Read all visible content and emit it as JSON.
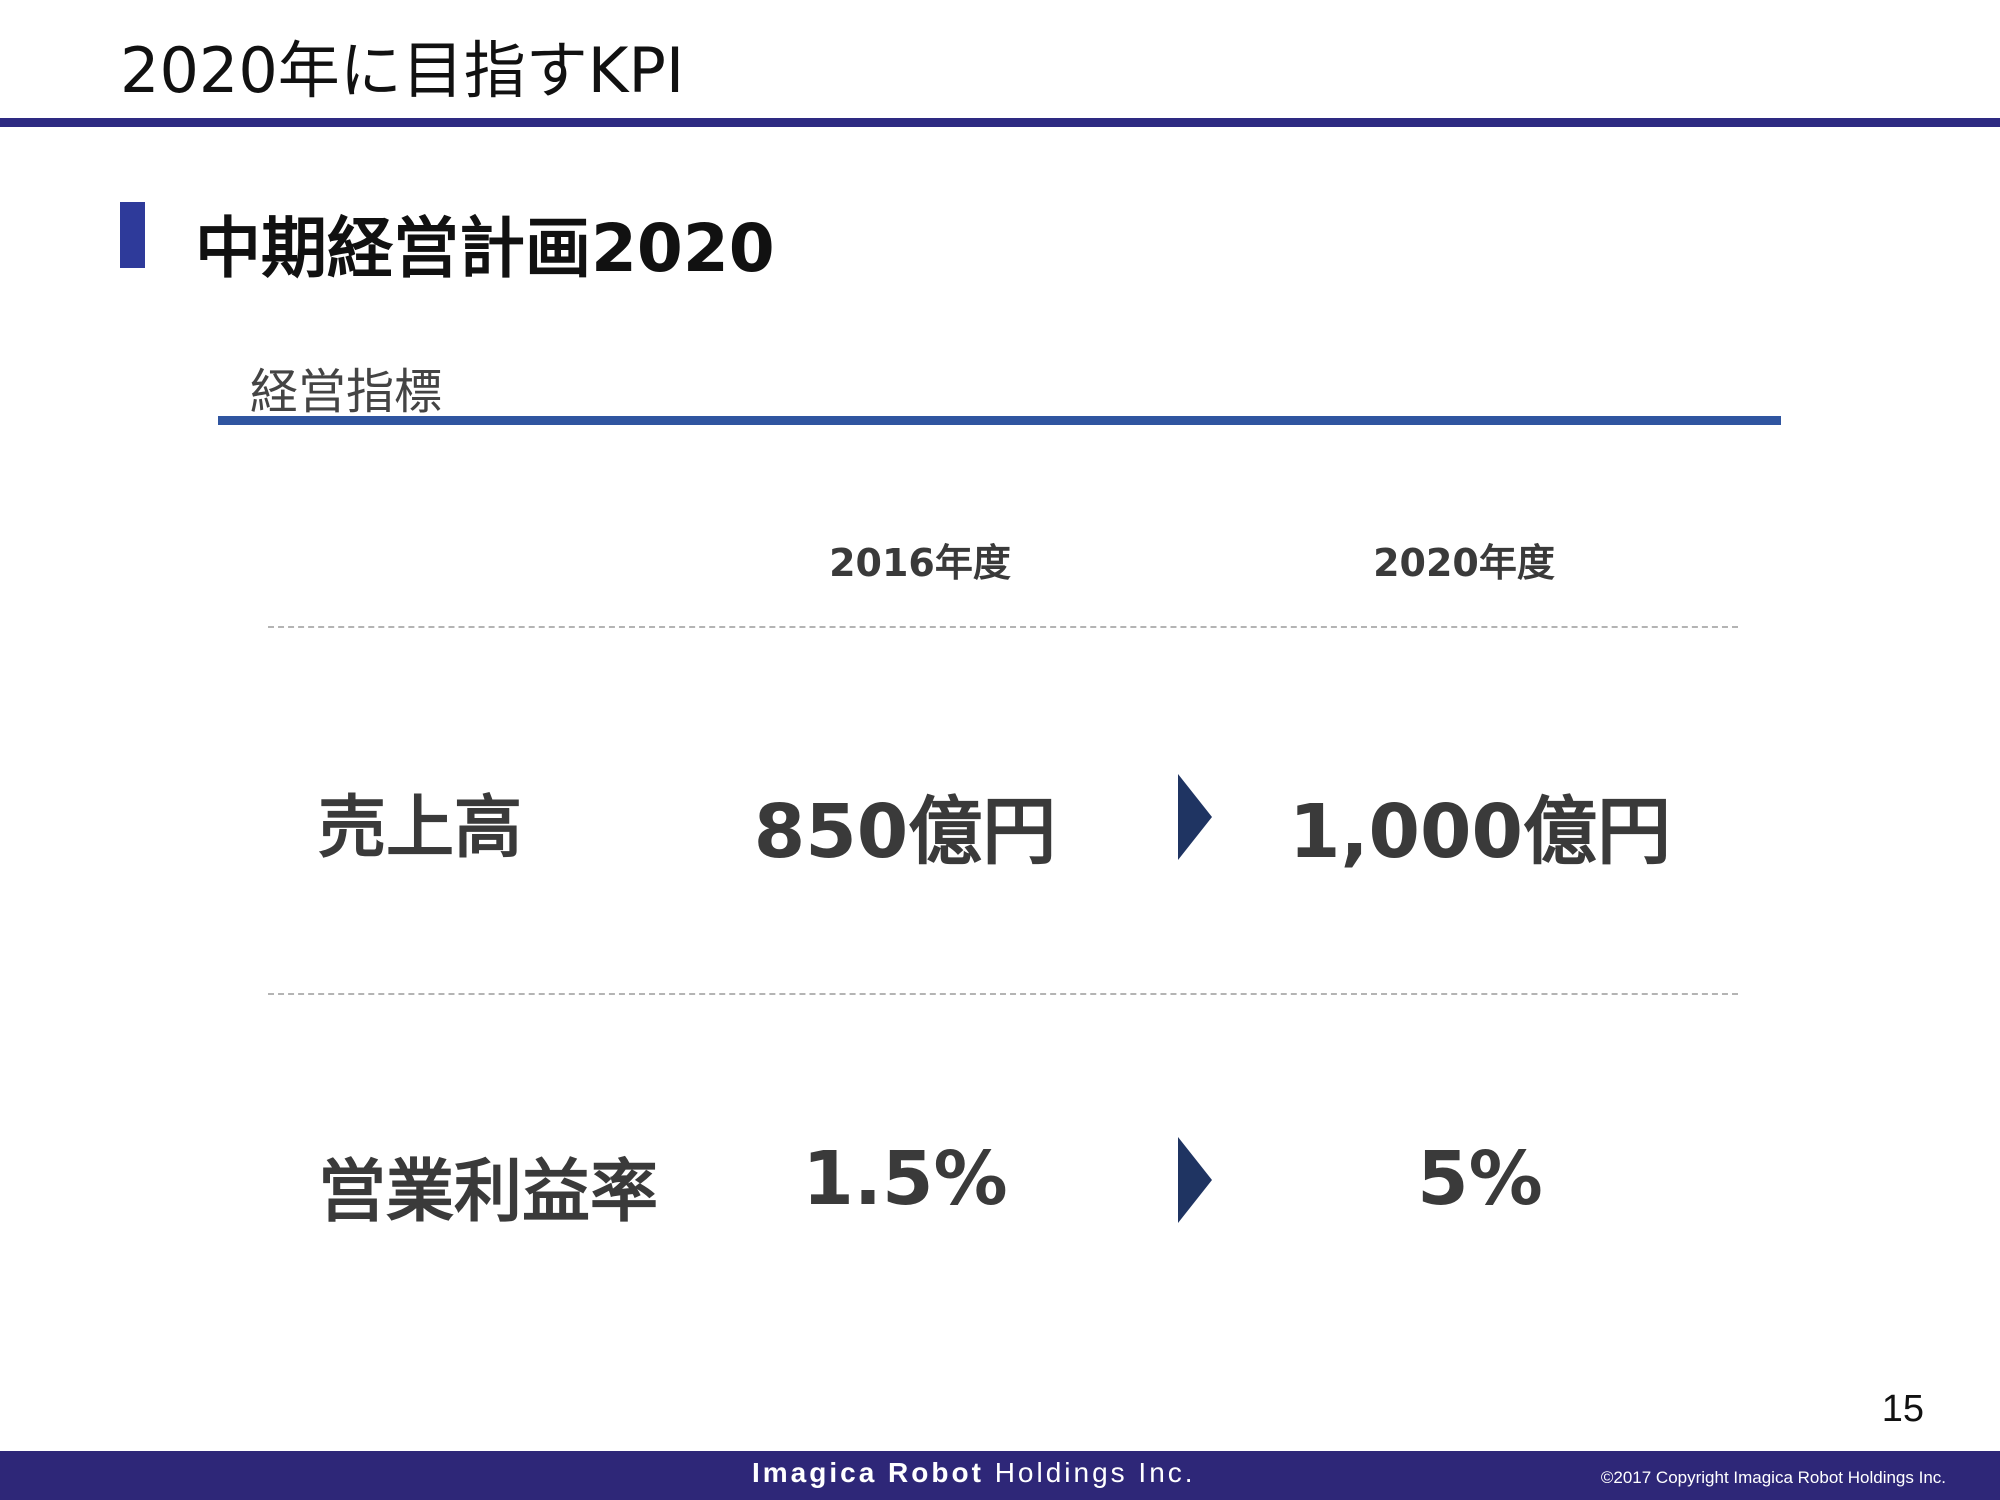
{
  "slide": {
    "title": "2020年に目指すKPI",
    "section_heading": "中期経営計画2020",
    "subsection_label": "経営指標",
    "page_number": "15"
  },
  "table": {
    "columns": [
      "2016年度",
      "2020年度"
    ],
    "rows": [
      {
        "label": "売上高",
        "value_2016": "850億円",
        "value_2020": "1,000億円"
      },
      {
        "label": "営業利益率",
        "value_2016": "1.5%",
        "value_2020": "5%"
      }
    ]
  },
  "footer": {
    "company_bold": "Imagica Robot",
    "company_rest": " Holdings Inc.",
    "copyright": "©2017  Copyright Imagica Robot Holdings Inc."
  },
  "colors": {
    "title_rule": "#2e2a82",
    "section_marker": "#2e3a9a",
    "subsection_rule": "#2f55a0",
    "arrow": "#1f3462",
    "footer_bar": "#2e2778"
  }
}
